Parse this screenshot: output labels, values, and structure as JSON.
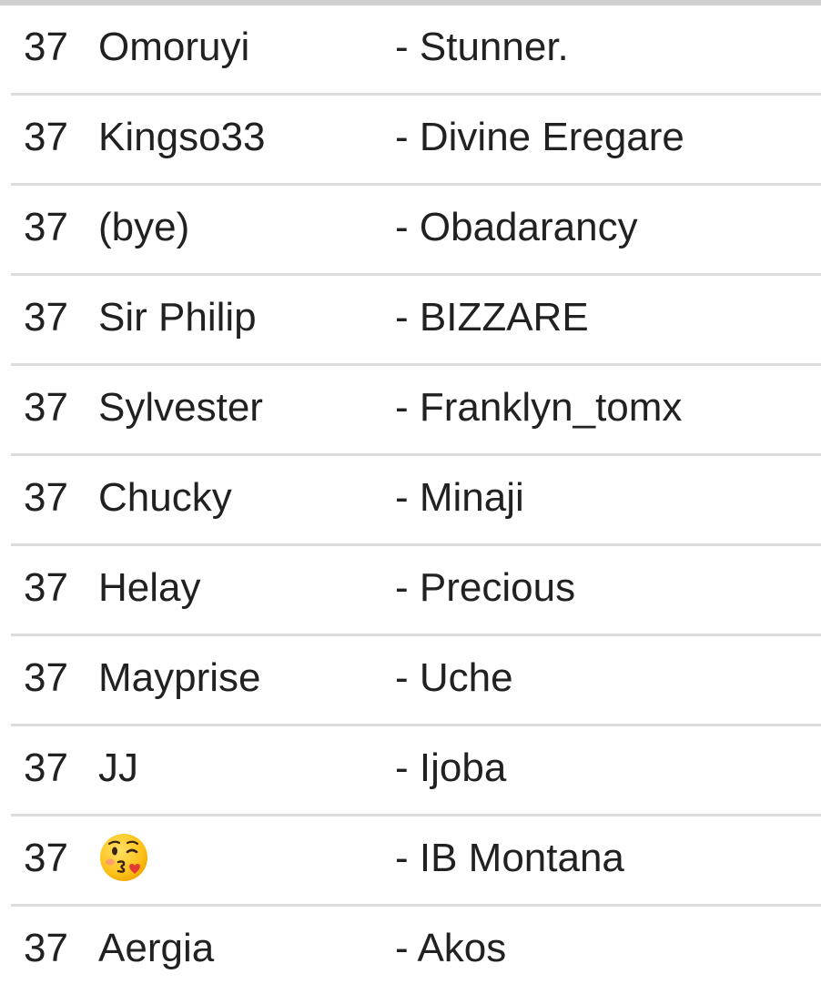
{
  "rows": [
    {
      "num": "37",
      "name": "Omoruyi",
      "partner": "- Stunner."
    },
    {
      "num": "37",
      "name": "Kingso33",
      "partner": "- Divine Eregare"
    },
    {
      "num": "37",
      "name": "(bye)",
      "partner": "- Obadarancy"
    },
    {
      "num": "37",
      "name": "Sir Philip",
      "partner": "- BIZZARE"
    },
    {
      "num": "37",
      "name": "Sylvester",
      "partner": "- Franklyn_tomx"
    },
    {
      "num": "37",
      "name": "Chucky",
      "partner": "- Minaji"
    },
    {
      "num": "37",
      "name": "Helay",
      "partner": "- Precious"
    },
    {
      "num": "37",
      "name": "Mayprise",
      "partner": "- Uche"
    },
    {
      "num": "37",
      "name": "JJ",
      "partner": "- Ijoba"
    },
    {
      "num": "37",
      "name": "",
      "name_icon": "face-blowing-kiss-icon",
      "partner": "- IB Montana"
    },
    {
      "num": "37",
      "name": "Aergia",
      "partner": "- Akos"
    }
  ],
  "colors": {
    "text": "#212121",
    "divider": "#dcdcdc",
    "top_bar": "#d0d0d0"
  }
}
